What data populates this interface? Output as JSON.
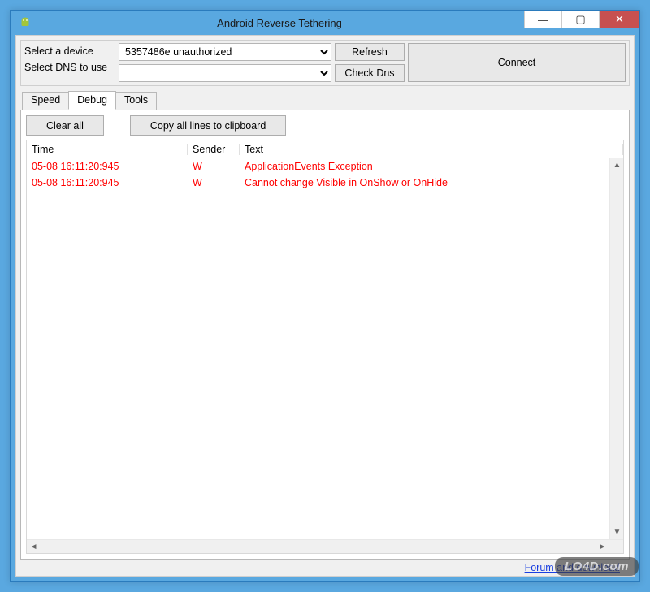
{
  "window": {
    "title": "Android Reverse Tethering",
    "minimize": "—",
    "maximize": "▢",
    "close": "✕"
  },
  "top": {
    "device_label": "Select a device",
    "dns_label": "Select DNS to use",
    "device_value": "5357486e  unauthorized",
    "dns_value": "",
    "refresh": "Refresh",
    "checkdns": "Check Dns",
    "connect": "Connect"
  },
  "tabs": {
    "speed": "Speed",
    "debug": "Debug",
    "tools": "Tools",
    "active": "Debug"
  },
  "toolbar": {
    "clear": "Clear all",
    "copy": "Copy all lines to clipboard"
  },
  "columns": {
    "time": "Time",
    "sender": "Sender",
    "text": "Text"
  },
  "rows": [
    {
      "time": "05-08 16:11:20:945",
      "sender": "W",
      "text": "ApplicationEvents Exception"
    },
    {
      "time": "05-08 16:11:20:945",
      "sender": "W",
      "text": "Cannot change Visible in OnShow or OnHide"
    }
  ],
  "footer": {
    "link": "Forum and download"
  },
  "watermark": "LO4D.com"
}
